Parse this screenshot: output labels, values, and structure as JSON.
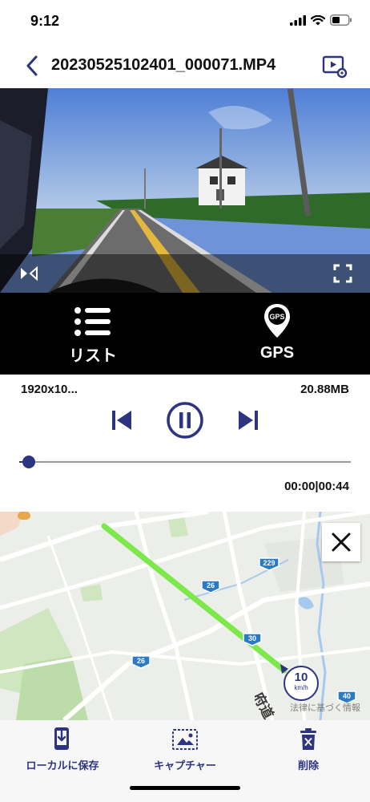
{
  "status": {
    "time": "9:12"
  },
  "header": {
    "title": "20230525102401_000071.MP4",
    "back_icon": "chevron-left-icon",
    "settings_icon": "video-settings-icon"
  },
  "player_actions": {
    "list_label": "リスト",
    "gps_label": "GPS",
    "gps_pin_text": "GPS"
  },
  "file_info": {
    "resolution": "1920x10...",
    "size": "20.88MB"
  },
  "playback": {
    "progress": 0.0,
    "time_readout": "00:00|00:44"
  },
  "map": {
    "speed_value": "10",
    "speed_unit": "km/h",
    "route_labels": [
      "229",
      "26",
      "26",
      "30",
      "40"
    ],
    "road_name": "府道",
    "notice": "法律に基づく情報"
  },
  "toolbar": {
    "save_label": "ローカルに保存",
    "capture_label": "キャプチャー",
    "delete_label": "削除"
  },
  "colors": {
    "accent": "#2d3480",
    "route": "#7de84a",
    "black_bar": "#000000"
  }
}
